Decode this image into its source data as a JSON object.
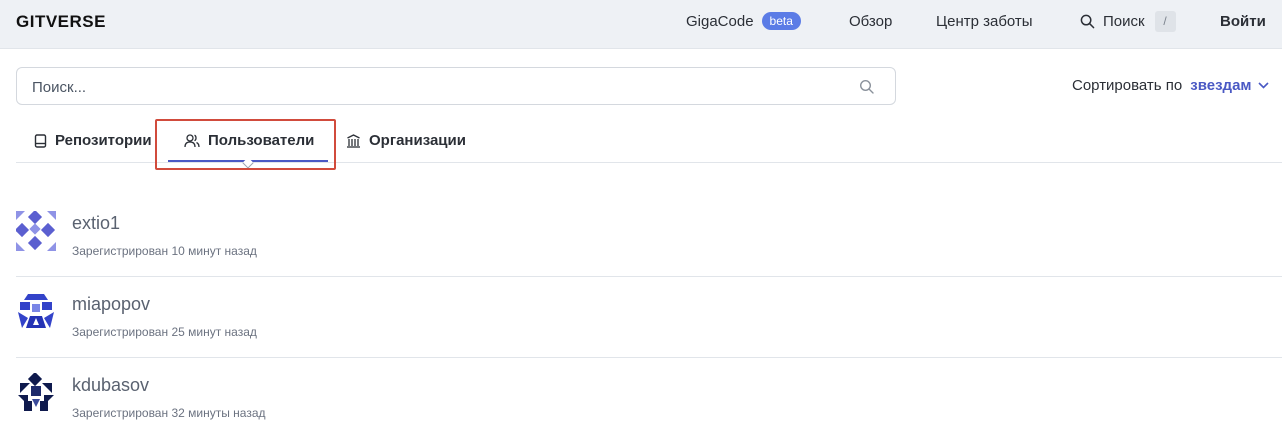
{
  "header": {
    "logo_text": "GITVERSE",
    "nav": {
      "gigacode": "GigaCode",
      "beta_badge": "beta",
      "overview": "Обзор",
      "care_center": "Центр заботы",
      "search": "Поиск",
      "search_shortcut": "/",
      "login": "Войти"
    }
  },
  "search": {
    "placeholder": "Поиск..."
  },
  "sort": {
    "label": "Сортировать по",
    "value": "звездам"
  },
  "tabs": [
    {
      "label": "Репозитории",
      "icon": "repo-icon",
      "active": false
    },
    {
      "label": "Пользователи",
      "icon": "users-icon",
      "active": true
    },
    {
      "label": "Организации",
      "icon": "organization-icon",
      "active": false
    }
  ],
  "users": [
    {
      "username": "extio1",
      "registered": "Зарегистрирован 10 минут назад"
    },
    {
      "username": "miapopov",
      "registered": "Зарегистрирован 25 минут назад"
    },
    {
      "username": "kdubasov",
      "registered": "Зарегистрирован 32 минуты назад"
    }
  ],
  "colors": {
    "accent": "#4a59c4",
    "beta_badge": "#5b7ce6",
    "highlight_box": "#d14b3c"
  }
}
